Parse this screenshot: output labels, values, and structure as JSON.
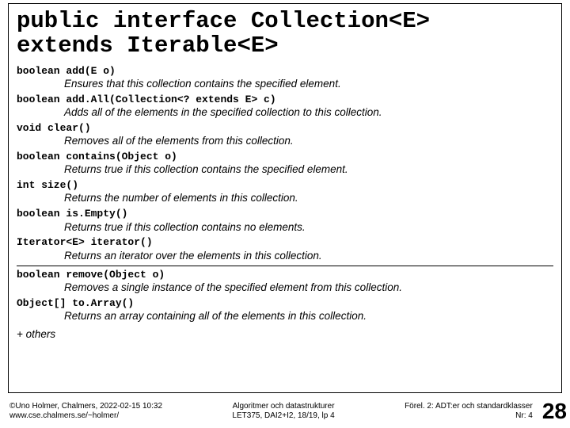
{
  "title_line1": "public interface Collection<E>",
  "title_line2": "extends Iterable<E>",
  "methods": [
    {
      "sig": "boolean add(E o)",
      "desc": "Ensures that this collection contains the specified element."
    },
    {
      "sig": "boolean add.All(Collection<? extends E> c)",
      "desc": "Adds all of the elements in the specified collection to this collection."
    },
    {
      "sig": "void clear()",
      "desc": "Removes all of the elements from this collection."
    },
    {
      "sig": "boolean contains(Object o)",
      "desc": "Returns true if this collection contains the specified element."
    },
    {
      "sig": "int size()",
      "desc": "Returns the number of elements in this collection."
    },
    {
      "sig": "boolean is.Empty()",
      "desc": "Returns true if this collection contains no elements."
    },
    {
      "sig": "Iterator<E> iterator()",
      "desc": "Returns an iterator over the elements in this collection."
    }
  ],
  "sep_before_index": 7,
  "methods2": [
    {
      "sig": "boolean remove(Object o)",
      "desc": "Removes a single instance of the specified element from this collection."
    },
    {
      "sig": "Object[] to.Array()",
      "desc": "Returns an array containing all of the elements in this collection."
    }
  ],
  "others": "+ others",
  "footer": {
    "left1": "©Uno Holmer, Chalmers, 2022-02-15 10:32",
    "left2": "www.cse.chalmers.se/~holmer/",
    "center1": "Algoritmer och datastrukturer",
    "center2": "LET375, DAI2+I2, 18/19, lp 4",
    "right1": "Förel. 2: ADT:er och standardklasser",
    "right2": "Nr: 4",
    "slidenum": "28"
  }
}
